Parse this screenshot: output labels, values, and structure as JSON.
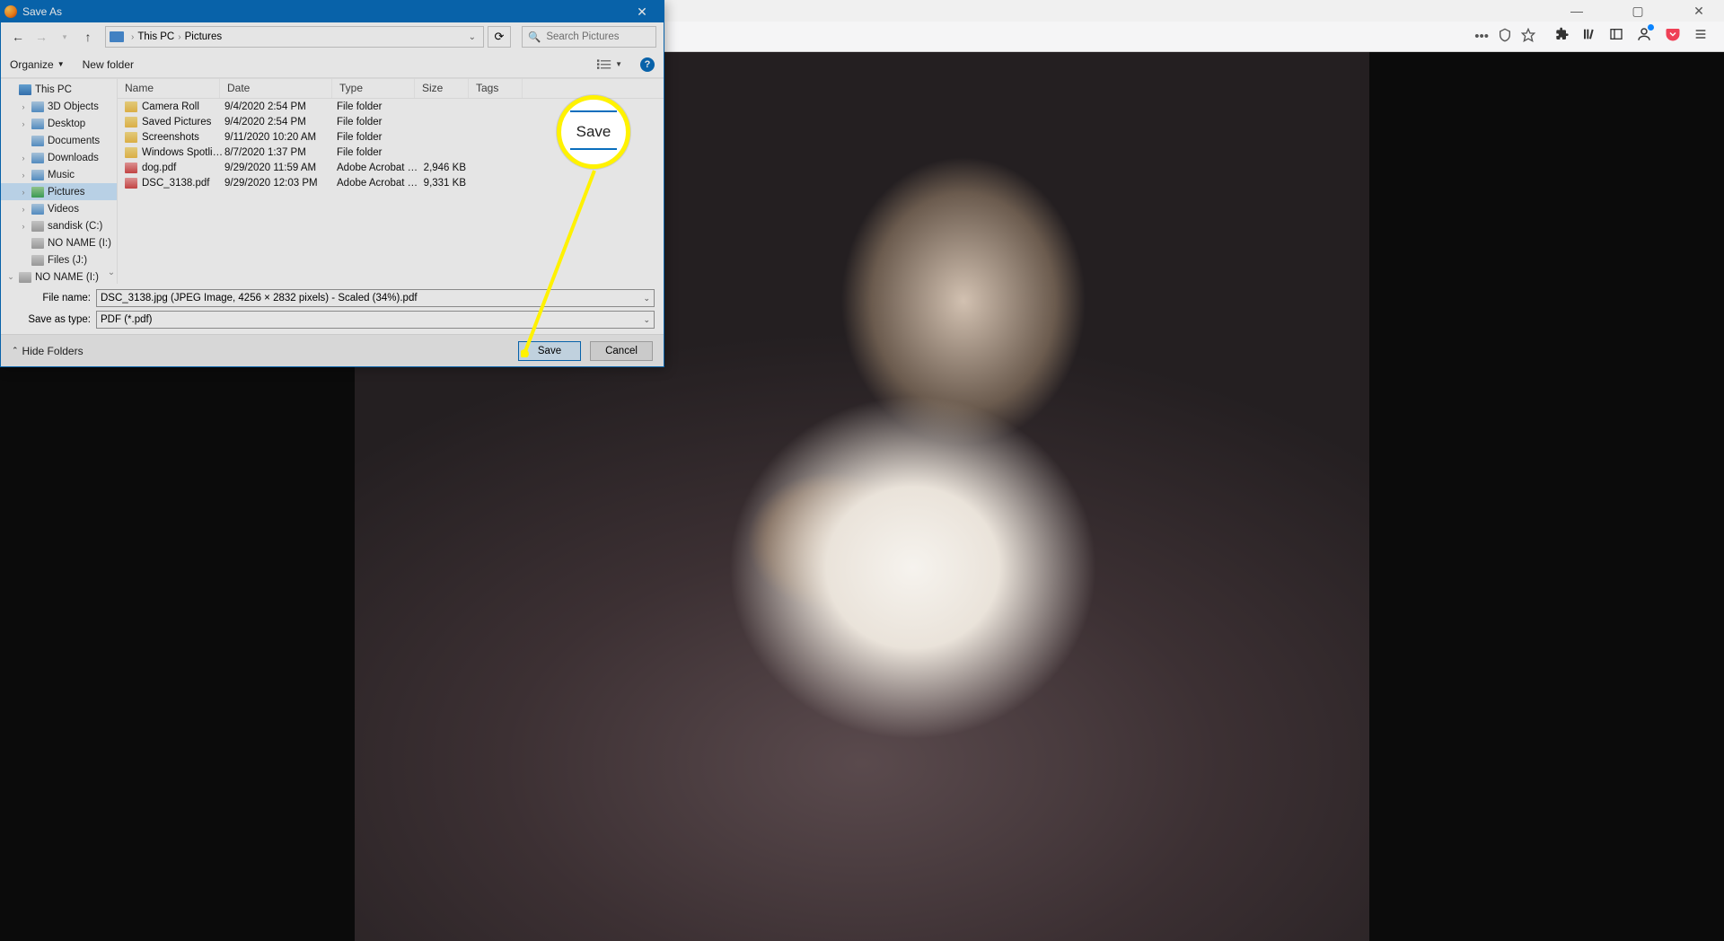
{
  "browser": {
    "toolbar": {
      "more": "•••"
    }
  },
  "dialog": {
    "title": "Save As",
    "breadcrumb": {
      "root": "This PC",
      "current": "Pictures"
    },
    "search_placeholder": "Search Pictures",
    "organize": "Organize",
    "new_folder": "New folder",
    "help": "?",
    "tree": [
      {
        "label": "This PC",
        "icon": "pc",
        "expanded": true,
        "level": 0
      },
      {
        "label": "3D Objects",
        "icon": "3d",
        "level": 1,
        "chev": ">"
      },
      {
        "label": "Desktop",
        "icon": "desk",
        "level": 1,
        "chev": ">"
      },
      {
        "label": "Documents",
        "icon": "doc",
        "level": 1,
        "chev": ""
      },
      {
        "label": "Downloads",
        "icon": "dl",
        "level": 1,
        "chev": ">"
      },
      {
        "label": "Music",
        "icon": "music",
        "level": 1,
        "chev": ">"
      },
      {
        "label": "Pictures",
        "icon": "pic",
        "level": 1,
        "chev": ">",
        "selected": true
      },
      {
        "label": "Videos",
        "icon": "video",
        "level": 1,
        "chev": ">"
      },
      {
        "label": "sandisk (C:)",
        "icon": "drive",
        "level": 1,
        "chev": ">"
      },
      {
        "label": "NO NAME (I:)",
        "icon": "drive",
        "level": 1,
        "chev": ""
      },
      {
        "label": "Files (J:)",
        "icon": "drive",
        "level": 1,
        "chev": ""
      },
      {
        "label": "NO NAME (I:)",
        "icon": "drive",
        "level": 0,
        "chev": "v"
      }
    ],
    "columns": {
      "name": "Name",
      "date": "Date",
      "type": "Type",
      "size": "Size",
      "tags": "Tags"
    },
    "files": [
      {
        "name": "Camera Roll",
        "date": "9/4/2020 2:54 PM",
        "type": "File folder",
        "size": "",
        "icon": "folder"
      },
      {
        "name": "Saved Pictures",
        "date": "9/4/2020 2:54 PM",
        "type": "File folder",
        "size": "",
        "icon": "folder"
      },
      {
        "name": "Screenshots",
        "date": "9/11/2020 10:20 AM",
        "type": "File folder",
        "size": "",
        "icon": "folder"
      },
      {
        "name": "Windows Spotlight ...",
        "date": "8/7/2020 1:37 PM",
        "type": "File folder",
        "size": "",
        "icon": "folder"
      },
      {
        "name": "dog.pdf",
        "date": "9/29/2020 11:59 AM",
        "type": "Adobe Acrobat D...",
        "size": "2,946 KB",
        "icon": "pdf"
      },
      {
        "name": "DSC_3138.pdf",
        "date": "9/29/2020 12:03 PM",
        "type": "Adobe Acrobat D...",
        "size": "9,331 KB",
        "icon": "pdf"
      }
    ],
    "file_name_label": "File name:",
    "file_name_value": "DSC_3138.jpg (JPEG Image, 4256 × 2832 pixels) - Scaled (34%).pdf",
    "save_type_label": "Save as type:",
    "save_type_value": "PDF (*.pdf)",
    "hide_folders": "Hide Folders",
    "save": "Save",
    "cancel": "Cancel"
  },
  "callout": {
    "label": "Save"
  }
}
